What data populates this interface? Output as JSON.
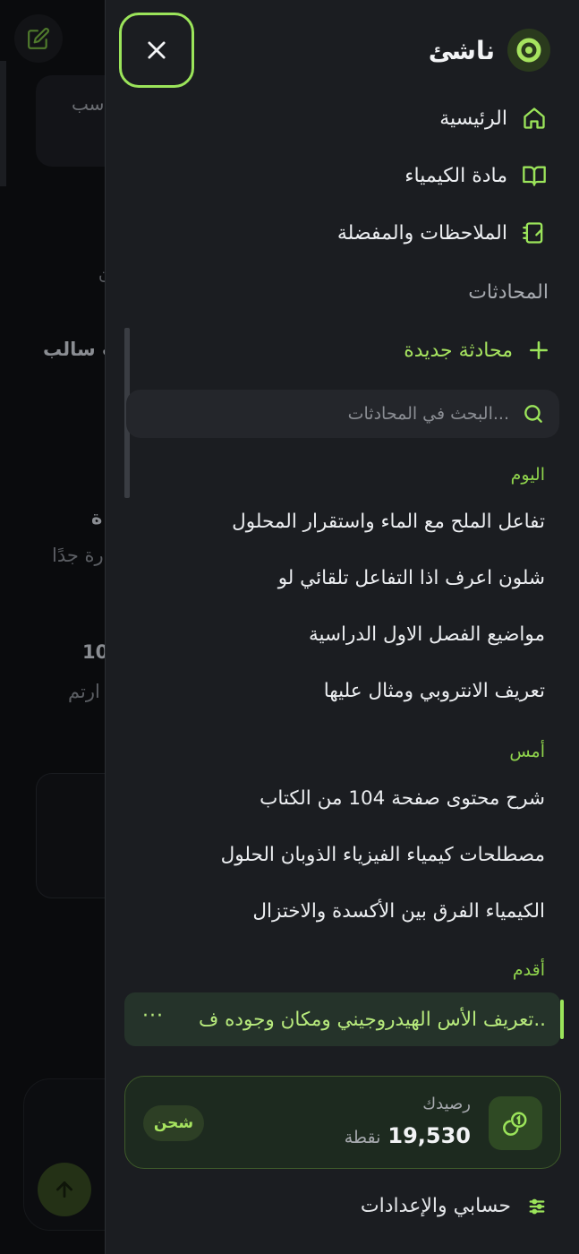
{
  "colors": {
    "accent": "#9be45a",
    "drawer_bg": "#1b1d21",
    "page_bg": "#0a0b0d"
  },
  "background": {
    "card_text": "سب",
    "line_a": "ن",
    "line_b": "ب سالب",
    "line_c": "ة",
    "line_d": "رة جدًا",
    "line_e": "10.",
    "line_f": "ارتم"
  },
  "brand": {
    "name": "ناشئ",
    "icon": "logo-ring-icon"
  },
  "nav": [
    {
      "label": "الرئيسية",
      "icon": "home-icon"
    },
    {
      "label": "مادة الكيمياء",
      "icon": "book-icon"
    },
    {
      "label": "الملاحظات والمفضلة",
      "icon": "notebook-icon"
    }
  ],
  "conversations_section": {
    "title": "المحادثات",
    "new_chat_label": "محادثة جديدة",
    "search_placeholder": "البحث في المحادثات..."
  },
  "groups": {
    "today": {
      "label": "اليوم",
      "items": [
        "تفاعل الملح مع الماء واستقرار المحلول",
        "شلون اعرف اذا التفاعل تلقائي لو",
        "مواضيع الفصل الاول الدراسية",
        "تعريف الانتروبي ومثال عليها"
      ]
    },
    "yesterday": {
      "label": "أمس",
      "items": [
        "شرح محتوى صفحة 104 من الكتاب",
        "مصطلحات كيمياء الفيزياء الذوبان الحلول",
        "الكيمياء الفرق بين الأكسدة والاختزال"
      ]
    },
    "older": {
      "label": "أقدم",
      "active_item": "تعريف الأس الهيدروجيني ومكان وجوده ف..",
      "more_label": "···"
    }
  },
  "balance": {
    "label": "رصيدك",
    "amount": "19,530",
    "unit": "نقطة",
    "recharge_label": "شحن"
  },
  "settings": {
    "label": "حسابي والإعدادات",
    "icon": "sliders-icon"
  }
}
